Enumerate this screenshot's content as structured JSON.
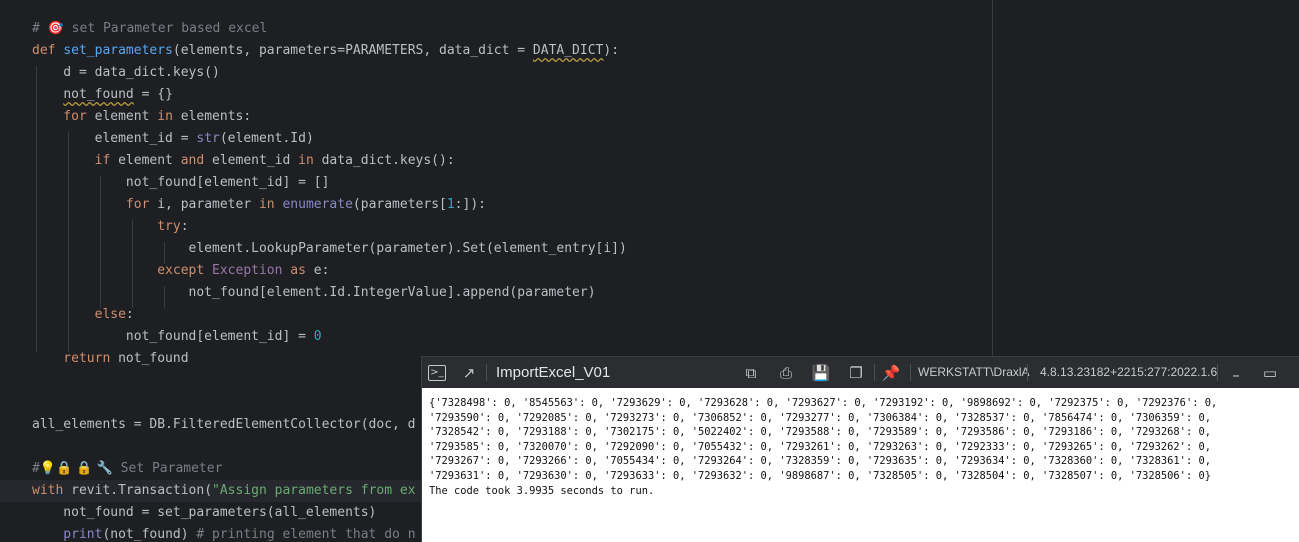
{
  "editor": {
    "lines": [
      {
        "parts": [
          [
            "cm",
            "# "
          ],
          [
            "emo",
            "🎯"
          ],
          [
            "cm",
            " set Parameter based excel"
          ]
        ]
      },
      {
        "parts": [
          [
            "kw",
            "def "
          ],
          [
            "fn",
            "set_parameters"
          ],
          [
            "",
            "(elements, parameters=PARAMETERS, data_dict = "
          ],
          [
            "squig",
            "DATA_DICT"
          ],
          [
            "",
            "):"
          ]
        ]
      },
      {
        "parts": [
          [
            "",
            "    d = data_dict.keys()"
          ]
        ]
      },
      {
        "parts": [
          [
            "",
            "    "
          ],
          [
            "squig",
            "not_found"
          ],
          [
            "",
            " = {}"
          ]
        ]
      },
      {
        "parts": [
          [
            "kw",
            "    for "
          ],
          [
            "",
            "element "
          ],
          [
            "kw",
            "in "
          ],
          [
            "",
            "elements:"
          ]
        ]
      },
      {
        "parts": [
          [
            "",
            "        element_id = "
          ],
          [
            "bi",
            "str"
          ],
          [
            "",
            "(element.Id)"
          ]
        ]
      },
      {
        "parts": [
          [
            "kw",
            "        if "
          ],
          [
            "",
            "element "
          ],
          [
            "kw",
            "and "
          ],
          [
            "",
            "element_id "
          ],
          [
            "kw",
            "in "
          ],
          [
            "",
            "data_dict.keys():"
          ]
        ]
      },
      {
        "parts": [
          [
            "",
            "            not_found[element_id] = []"
          ]
        ]
      },
      {
        "parts": [
          [
            "kw",
            "            for "
          ],
          [
            "",
            "i, parameter "
          ],
          [
            "kw",
            "in "
          ],
          [
            "bi",
            "enumerate"
          ],
          [
            "",
            "(parameters["
          ],
          [
            "num",
            "1"
          ],
          [
            "",
            ":]):"
          ]
        ]
      },
      {
        "parts": [
          [
            "kw",
            "                try"
          ],
          [
            "",
            ":"
          ]
        ]
      },
      {
        "parts": [
          [
            "",
            "                    element.LookupParameter(parameter).Set(element_entry[i])"
          ]
        ]
      },
      {
        "parts": [
          [
            "kw",
            "                except "
          ],
          [
            "purp",
            "Exception"
          ],
          [
            "kw",
            " as "
          ],
          [
            "",
            "e:"
          ]
        ]
      },
      {
        "parts": [
          [
            "",
            "                    not_found[element.Id.IntegerValue].append(parameter)"
          ]
        ]
      },
      {
        "parts": [
          [
            "kw",
            "        else"
          ],
          [
            "",
            ":"
          ]
        ]
      },
      {
        "parts": [
          [
            "",
            "            not_found[element_id] = "
          ],
          [
            "num",
            "0"
          ]
        ]
      },
      {
        "parts": [
          [
            "kw",
            "    return "
          ],
          [
            "",
            "not_found"
          ]
        ]
      },
      {
        "parts": []
      },
      {
        "parts": []
      },
      {
        "parts": [
          [
            "",
            "all_elements = DB.FilteredElementCollector(doc, d"
          ]
        ]
      },
      {
        "parts": []
      },
      {
        "parts": [
          [
            "cm",
            "#"
          ],
          [
            "emo",
            "💡🔒 🔒 🔧"
          ],
          [
            "cm",
            " Set Parameter"
          ]
        ]
      },
      {
        "parts": [
          [
            "kw",
            "with "
          ],
          [
            "",
            "revit.Transaction("
          ],
          [
            "str",
            "\"Assign parameters from ex"
          ]
        ]
      },
      {
        "parts": [
          [
            "",
            "    not_found = set_parameters(all_elements)"
          ]
        ]
      },
      {
        "parts": [
          [
            "bi",
            "    print"
          ],
          [
            "",
            "(not_found) "
          ],
          [
            "cm",
            "# printing element that do n"
          ]
        ]
      }
    ]
  },
  "console": {
    "title": "ImportExcel_V01",
    "user": "WERKSTATT\\DraxlA",
    "version": "4.8.13.23182+2215:277:2022.1.6",
    "output_lines": [
      "{'7328498': 0, '8545563': 0, '7293629': 0, '7293628': 0, '7293627': 0, '7293192': 0, '9898692': 0, '7292375': 0, '7292376': 0,",
      "'7293590': 0, '7292085': 0, '7293273': 0, '7306852': 0, '7293277': 0, '7306384': 0, '7328537': 0, '7856474': 0, '7306359': 0,",
      "'7328542': 0, '7293188': 0, '7302175': 0, '5022402': 0, '7293588': 0, '7293589': 0, '7293586': 0, '7293186': 0, '7293268': 0,",
      "'7293585': 0, '7320070': 0, '7292090': 0, '7055432': 0, '7293261': 0, '7293263': 0, '7292333': 0, '7293265': 0, '7293262': 0,",
      "'7293267': 0, '7293266': 0, '7055434': 0, '7293264': 0, '7328359': 0, '7293635': 0, '7293634': 0, '7328360': 0, '7328361': 0,",
      "'7293631': 0, '7293630': 0, '7293633': 0, '7293632': 0, '9898687': 0, '7328505': 0, '7328504': 0, '7328507': 0, '7328506': 0}",
      "The code took 3.9935 seconds to run."
    ]
  },
  "colors": {
    "editor_bg": "#1e1f22",
    "keyword": "#cf8e6d",
    "function": "#56a8f5",
    "builtin": "#8888c6",
    "comment": "#7a7e85",
    "number": "#2aacb8",
    "string": "#6aab73",
    "titlebar": "#2b2d30"
  },
  "icons": {
    "terminal": "terminal-icon",
    "arrow": "arrow-up-right-icon",
    "open_external": "open-external-icon",
    "print": "print-icon",
    "save": "save-icon",
    "copy": "copy-icon",
    "pin": "pin-off-icon",
    "minimize": "minimize-icon",
    "maximize": "maximize-icon"
  }
}
